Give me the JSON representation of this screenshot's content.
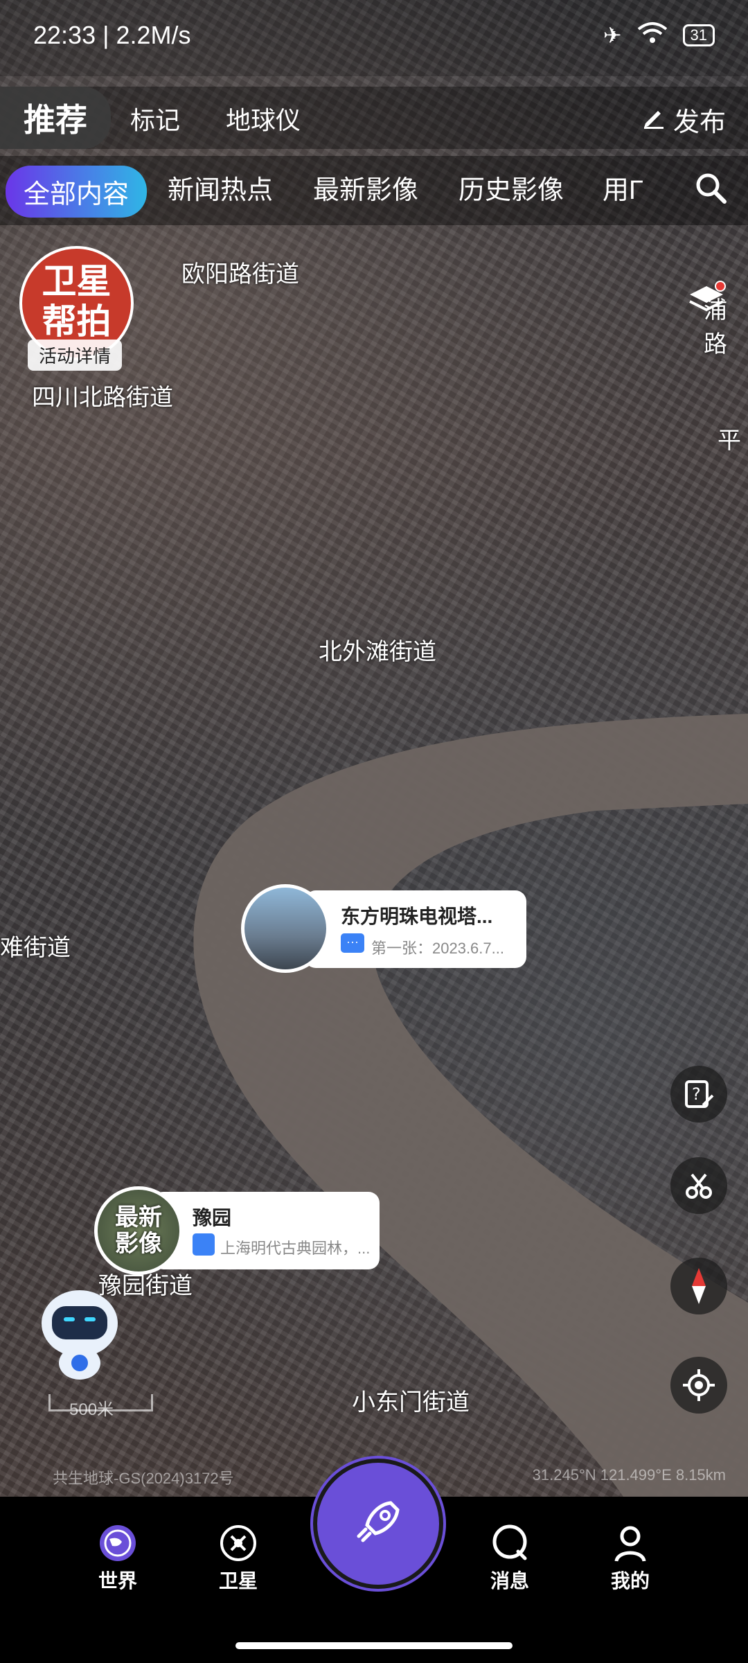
{
  "status": {
    "time": "22:33 | 2.2M/s",
    "battery": "31"
  },
  "top_tabs": {
    "recommend": "推荐",
    "marks": "标记",
    "globe": "地球仪",
    "publish": "发布"
  },
  "chips": [
    "全部内容",
    "新闻热点",
    "最新影像",
    "历史影像",
    "用Г"
  ],
  "map_labels": {
    "ouyang": "欧阳路街道",
    "sichuan": "四川北路街道",
    "pudong": "浦路",
    "ping": "平",
    "beiwaitan": "北外滩街道",
    "left_street": "难街道",
    "yuyuan_street": "豫园街道",
    "xiaodongmen": "小东门街道"
  },
  "activity": {
    "badge": "卫星\n帮拍",
    "button": "活动详情"
  },
  "cards": {
    "oriental": {
      "title": "东方明珠电视塔...",
      "sub": "第一张：2023.6.7..."
    },
    "yuyuan": {
      "title": "豫园",
      "sub": "上海明代古典园林，...",
      "badge": "最新\n影像"
    }
  },
  "scale": "500米",
  "copyright": "共生地球-GS(2024)3172号",
  "coords": "31.245°N 121.499°E 8.15km",
  "nav": {
    "world": "世界",
    "satellite": "卫星",
    "messages": "消息",
    "mine": "我的"
  },
  "colors": {
    "accent": "#6a4fd8",
    "chip_gradient_start": "#6a36e8",
    "chip_gradient_end": "#2fb6e6"
  }
}
